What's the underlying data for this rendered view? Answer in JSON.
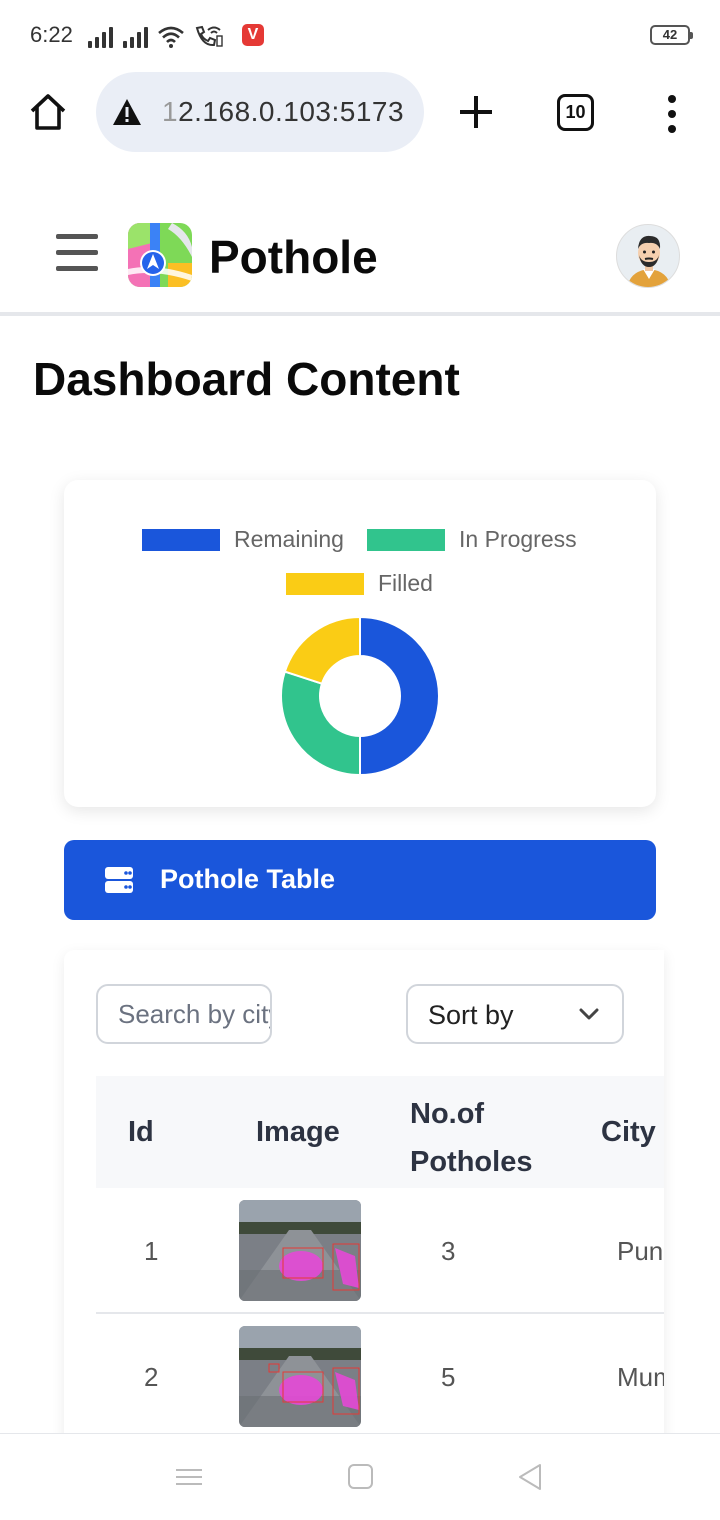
{
  "status_bar": {
    "time": "6:22",
    "battery": "42",
    "app_badge": "V"
  },
  "browser": {
    "url_hidden_prefix": "1",
    "url": "2.168.0.103:5173",
    "tab_count": "10"
  },
  "app": {
    "title": "Pothole"
  },
  "page": {
    "title": "Dashboard Content"
  },
  "chart_data": {
    "type": "pie",
    "variant": "doughnut",
    "labels": [
      "Remaining",
      "In Progress",
      "Filled"
    ],
    "values": [
      5,
      3,
      2
    ],
    "colors": [
      "#1a56db",
      "#31c48d",
      "#facc15"
    ],
    "legend_position": "top"
  },
  "table_section": {
    "label": "Pothole Table",
    "icon": "server-icon"
  },
  "controls": {
    "search_placeholder": "Search by city",
    "sort_label": "Sort by"
  },
  "table": {
    "headers": {
      "id": "Id",
      "image": "Image",
      "num_line1": "No.of",
      "num_line2": "Potholes",
      "city": "City"
    },
    "rows": [
      {
        "id": "1",
        "potholes": "3",
        "city": "Pune"
      },
      {
        "id": "2",
        "potholes": "5",
        "city": "Mumbai"
      }
    ]
  }
}
